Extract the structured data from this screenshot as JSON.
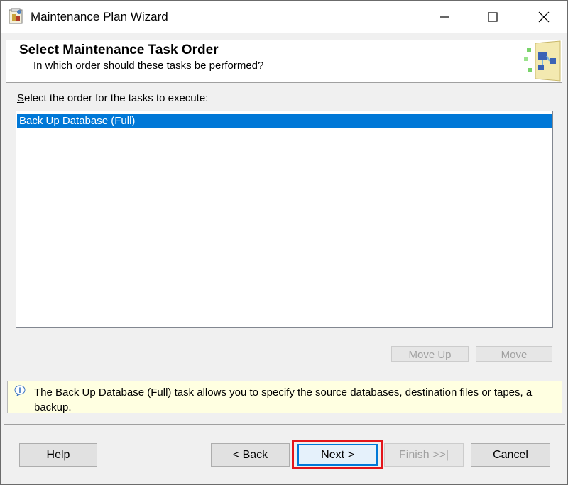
{
  "window": {
    "title": "Maintenance Plan Wizard"
  },
  "banner": {
    "title": "Select Maintenance Task Order",
    "subtitle": "In which order should these tasks be performed?"
  },
  "list": {
    "label_accel": "S",
    "label_rest": "elect the order for the tasks to execute:",
    "items": [
      "Back Up Database (Full)"
    ],
    "selected_index": 0
  },
  "move_buttons": {
    "up": "Move Up",
    "down": "Move"
  },
  "info": {
    "text_line1": "The Back Up Database (Full) task allows you to specify the source databases, destination files or tapes, a",
    "text_line2": "backup."
  },
  "buttons": {
    "help": "Help",
    "back": "< Back",
    "next": "Next >",
    "finish": "Finish >>|",
    "cancel": "Cancel"
  },
  "colors": {
    "selection": "#0078d7",
    "info_bg": "#ffffe1",
    "highlight_box": "#e3151a"
  }
}
